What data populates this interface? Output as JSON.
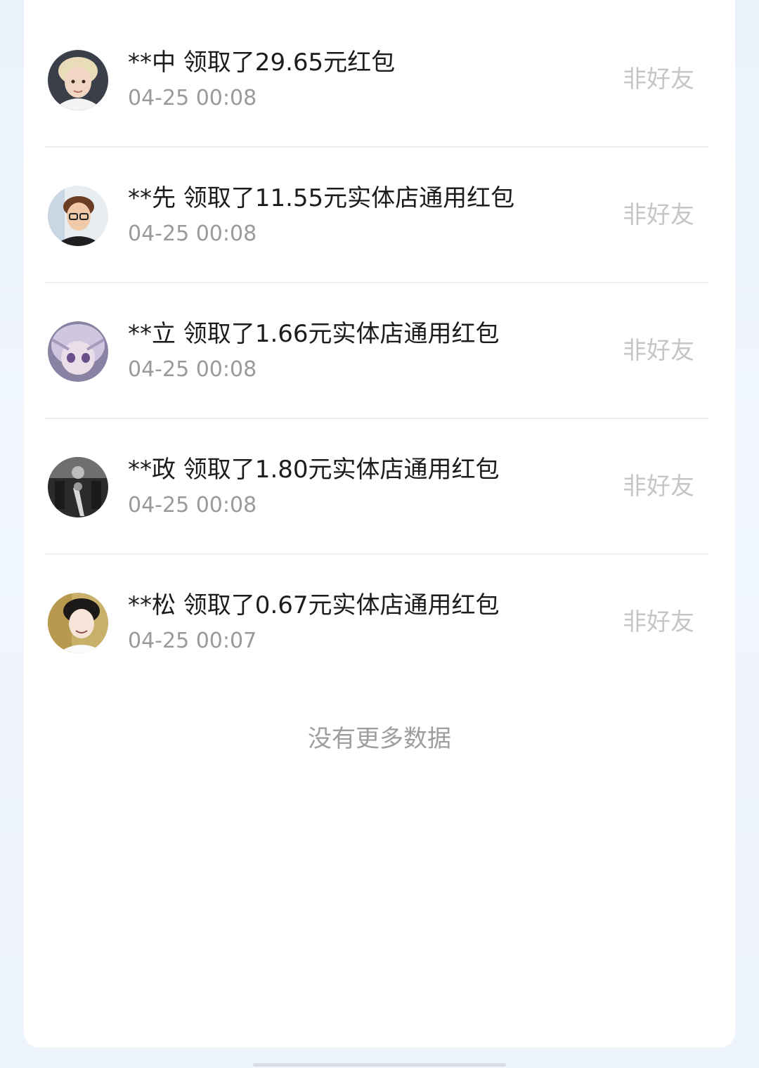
{
  "records": [
    {
      "title": "**中 领取了29.65元红包",
      "time": "04-25 00:08",
      "tag": "非好友"
    },
    {
      "title": "**先 领取了11.55元实体店通用红包",
      "time": "04-25 00:08",
      "tag": "非好友"
    },
    {
      "title": "**立 领取了1.66元实体店通用红包",
      "time": "04-25 00:08",
      "tag": "非好友"
    },
    {
      "title": "**政 领取了1.80元实体店通用红包",
      "time": "04-25 00:08",
      "tag": "非好友"
    },
    {
      "title": "**松 领取了0.67元实体店通用红包",
      "time": "04-25 00:07",
      "tag": "非好友"
    }
  ],
  "footer": {
    "no_more_text": "没有更多数据"
  },
  "colors": {
    "background": "#eaf2fc",
    "card": "#ffffff",
    "title_text": "#1c1c1c",
    "time_text": "#9a9a9a",
    "tag_text": "#c6c6c6",
    "divider": "#f0f0f0"
  }
}
